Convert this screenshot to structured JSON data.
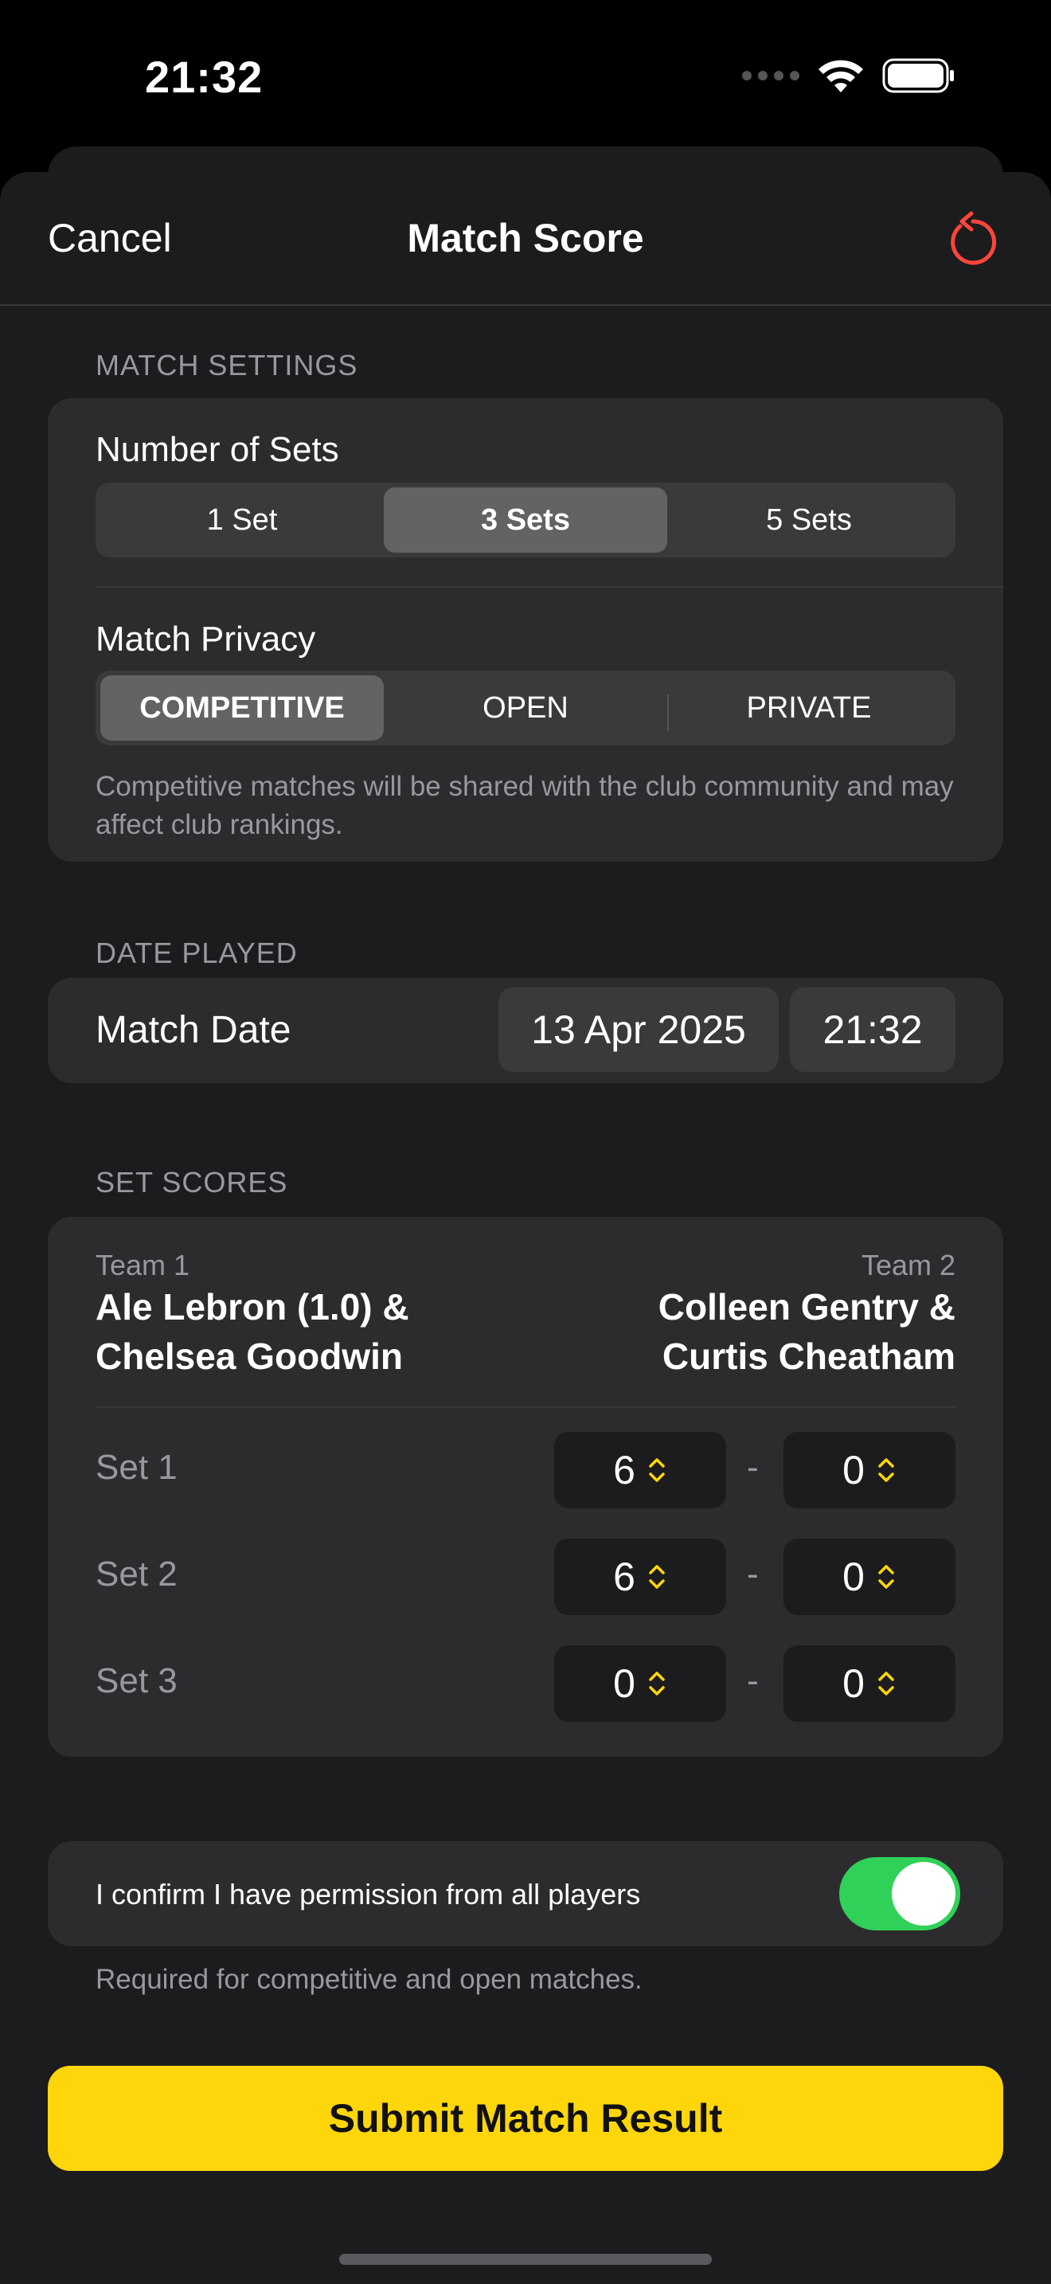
{
  "status_bar": {
    "time": "21:32"
  },
  "nav": {
    "cancel_label": "Cancel",
    "title": "Match Score",
    "reset_icon": "counterclockwise-arrow-icon"
  },
  "match_settings": {
    "header": "MATCH SETTINGS",
    "sets_label": "Number of Sets",
    "sets_options": [
      "1 Set",
      "3 Sets",
      "5 Sets"
    ],
    "sets_selected": "3 Sets",
    "privacy_label": "Match Privacy",
    "privacy_options": [
      "COMPETITIVE",
      "OPEN",
      "PRIVATE"
    ],
    "privacy_selected": "COMPETITIVE",
    "privacy_caption": "Competitive matches will be shared with the club community and may affect club rankings."
  },
  "date_played": {
    "header": "DATE PLAYED",
    "label": "Match Date",
    "date": "13 Apr 2025",
    "time": "21:32"
  },
  "set_scores": {
    "header": "SET SCORES",
    "team1": {
      "label": "Team 1",
      "player1": "Ale Lebron (1.0) &",
      "player2": "Chelsea Goodwin"
    },
    "team2": {
      "label": "Team 2",
      "player1": "Colleen Gentry &",
      "player2": "Curtis Cheatham"
    },
    "sets": [
      {
        "label": "Set 1",
        "team1": "6",
        "team2": "0"
      },
      {
        "label": "Set 2",
        "team1": "6",
        "team2": "0"
      },
      {
        "label": "Set 3",
        "team1": "0",
        "team2": "0"
      }
    ],
    "separator": "-"
  },
  "permission": {
    "label": "I confirm I have permission from all players",
    "enabled": true,
    "caption": "Required for competitive and open matches."
  },
  "submit_label": "Submit Match Result",
  "colors": {
    "accent": "#ffd60a",
    "toggle_on": "#30d158",
    "reset": "#ff453a",
    "stepper_chevron": "#ffd60a"
  }
}
